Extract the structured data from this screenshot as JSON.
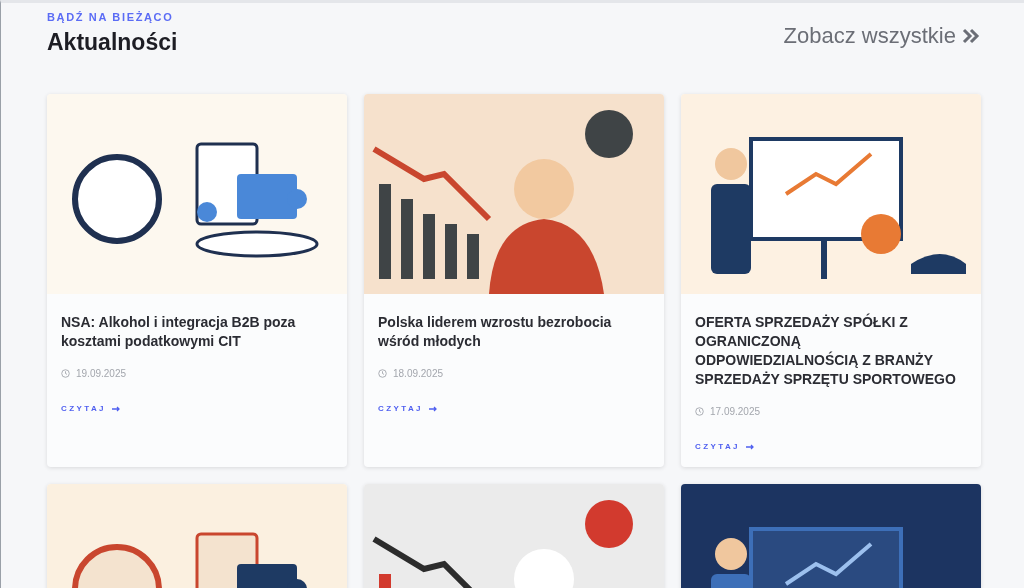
{
  "header": {
    "eyebrow": "BĄDŹ NA BIEŻĄCO",
    "title": "Aktualności",
    "see_all": "Zobacz wszystkie"
  },
  "articles": [
    {
      "image": {
        "kind": "picture"
      },
      "title": "NSA: Alkohol i integracja B2B poza kosztami podatkowymi CIT",
      "date": "19.09.2025",
      "link": "CZYTAJ"
    },
    {
      "image": {
        "kind": "picture"
      },
      "title": "Polska liderem wzrostu bezrobocia wśród młodych",
      "date": "18.09.2025",
      "link": "CZYTAJ"
    },
    {
      "image": {
        "kind": "picture"
      },
      "title": "OFERTA SPRZEDAŻY SPÓŁKI Z OGRANICZONĄ ODPOWIEDZIALNOŚCIĄ Z BRANŻY SPRZEDAŻY SPRZĘTU SPORTOWEGO",
      "date": "17.09.2025",
      "link": "CZYTAJ"
    },
    {
      "image": {
        "kind": "picture"
      }
    },
    {
      "image": {
        "kind": "picture"
      }
    },
    {
      "image": {
        "kind": "picture"
      }
    }
  ]
}
